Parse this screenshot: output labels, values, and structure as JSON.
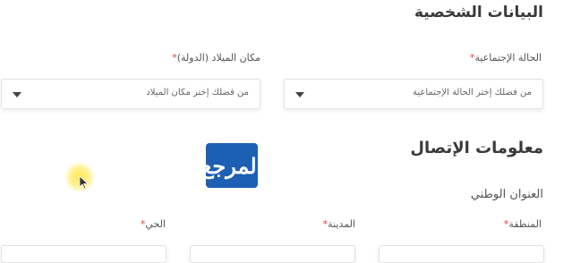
{
  "personal_section": {
    "title": "البيانات الشخصية",
    "marital_status": {
      "label": "الحالة الإجتماعية",
      "required_mark": "*",
      "placeholder": "من فضلك إختر الحالة الإجتماعية"
    },
    "birth_place": {
      "label": "مكان الميلاد (الدولة)",
      "required_mark": "*",
      "placeholder": "من فضلك إختر مكان الميلاد"
    }
  },
  "contact_section": {
    "title": "معلومات الإتصال",
    "address_subtitle": "العنوان الوطني",
    "region": {
      "label": "المنطقة",
      "required_mark": "*"
    },
    "city": {
      "label": "المدينة",
      "required_mark": "*"
    },
    "district": {
      "label": "الحي",
      "required_mark": "*"
    }
  },
  "watermark": {
    "logo_text": "المرجع",
    "color": "#1d5fb3"
  },
  "colors": {
    "required": "#e53935",
    "highlight": "#ffe63c"
  },
  "icons": [
    "chevron-down-icon",
    "cursor-icon"
  ]
}
